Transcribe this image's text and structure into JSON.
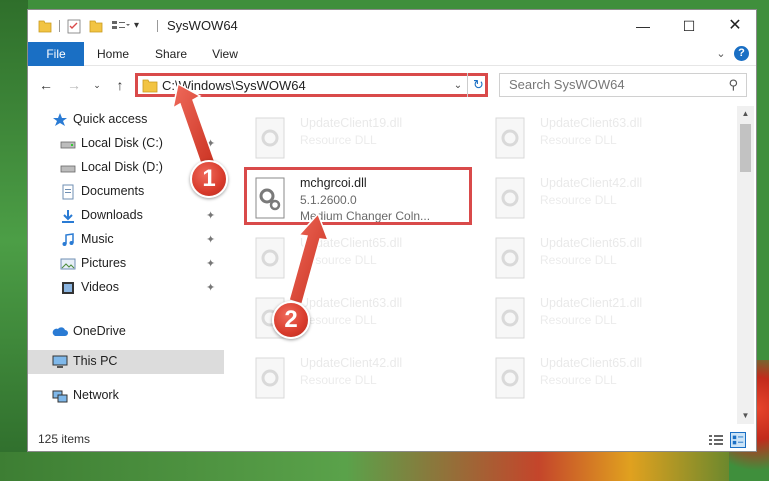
{
  "window": {
    "title": "SysWOW64",
    "controls": {
      "minimize": "—",
      "maximize": "☐",
      "close": "✕"
    }
  },
  "quick_access_toolbar": {
    "dropdown_glyph": "▾"
  },
  "ribbon": {
    "tabs": [
      "File",
      "Home",
      "Share",
      "View"
    ],
    "expand_glyph": "⌄",
    "help_glyph": "?"
  },
  "navigation": {
    "back_glyph": "←",
    "forward_glyph": "→",
    "recent_glyph": "⌄",
    "up_glyph": "↑"
  },
  "address_bar": {
    "path": "C:\\Windows\\SysWOW64",
    "dropdown_glyph": "⌄",
    "refresh_glyph": "↻"
  },
  "search": {
    "placeholder": "Search SysWOW64",
    "icon_glyph": "⚲"
  },
  "sidebar": {
    "items": [
      {
        "label": "Quick access",
        "icon": "star-icon",
        "pinned": false
      },
      {
        "label": "Local Disk (C:)",
        "icon": "drive-icon",
        "pinned": true
      },
      {
        "label": "Local Disk (D:)",
        "icon": "drive-icon",
        "pinned": true
      },
      {
        "label": "Documents",
        "icon": "documents-icon",
        "pinned": true
      },
      {
        "label": "Downloads",
        "icon": "downloads-icon",
        "pinned": true
      },
      {
        "label": "Music",
        "icon": "music-icon",
        "pinned": true
      },
      {
        "label": "Pictures",
        "icon": "pictures-icon",
        "pinned": true
      },
      {
        "label": "Videos",
        "icon": "videos-icon",
        "pinned": true
      },
      {
        "label": "OneDrive",
        "icon": "cloud-icon",
        "pinned": false
      },
      {
        "label": "This PC",
        "icon": "computer-icon",
        "pinned": false,
        "selected": true
      },
      {
        "label": "Network",
        "icon": "network-icon",
        "pinned": false
      }
    ],
    "pin_glyph": "📌"
  },
  "files": {
    "focused": {
      "name": "mchgrcoi.dll",
      "version": "5.1.2600.0",
      "description": "Medium Changer Coln..."
    },
    "others": [
      {
        "name": "UpdateClient19.dll",
        "desc": "Resource DLL"
      },
      {
        "name": "UpdateClient63.dll",
        "desc": "Resource DLL"
      },
      {
        "name": "UpdateClient42.dll",
        "desc": "Resource DLL"
      },
      {
        "name": "UpdateClient65.dll",
        "desc": "Resource DLL"
      },
      {
        "name": "UpdateClient65.dll",
        "desc": "Resource DLL"
      },
      {
        "name": "UpdateClient63.dll",
        "desc": "Resource DLL"
      },
      {
        "name": "UpdateClient21.dll",
        "desc": "Resource DLL"
      },
      {
        "name": "UpdateClient42.dll",
        "desc": "Resource DLL"
      },
      {
        "name": "UpdateClient65.dll",
        "desc": "Resource DLL"
      }
    ]
  },
  "status_bar": {
    "item_count": "125 items"
  },
  "annotations": {
    "step1": "1",
    "step2": "2"
  },
  "colors": {
    "accent": "#1a6fc4",
    "highlight_border": "#d94a4a",
    "marker": "#d83b2c",
    "selected_row": "#dcdcdc"
  }
}
